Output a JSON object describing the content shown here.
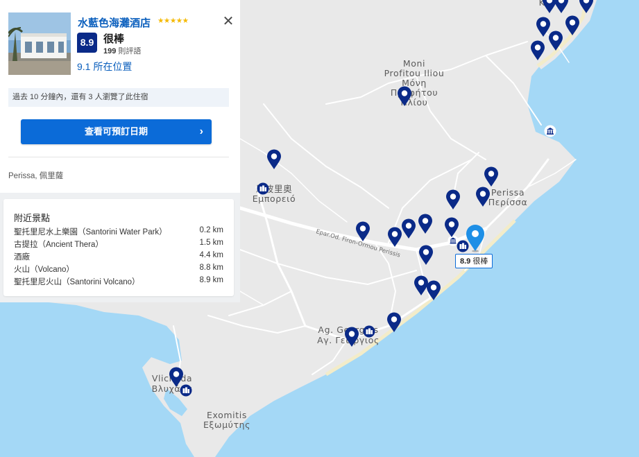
{
  "hotel": {
    "name": "水藍色海灘酒店",
    "stars": "★★★★★",
    "score": "8.9",
    "score_word": "很棒",
    "review_count": "199",
    "review_suffix": "則評語",
    "location_score": "9.1 所在位置",
    "viewers_text": "過去 10 分鐘內，還有 3 人瀏覽了此住宿",
    "cta_label": "查看可預訂日期",
    "address": "Perissa, 佩里薩"
  },
  "nearby": {
    "title": "附近景點",
    "items": [
      {
        "name": "聖托里尼水上樂園（Santorini Water Park）",
        "distance": "0.2 km"
      },
      {
        "name": "古提拉（Ancient Thera）",
        "distance": "1.5 km"
      },
      {
        "name": "酒廠",
        "distance": "4.4 km"
      },
      {
        "name": "火山（Volcano）",
        "distance": "8.8 km"
      },
      {
        "name": "聖托里尼火山（Santorini Volcano）",
        "distance": "8.9 km"
      }
    ]
  },
  "map": {
    "labels": {
      "moni1": "Moni",
      "moni2": "Profitou Iliou",
      "moni3": "Μόνη",
      "moni4": "Προφήτου",
      "moni5": "Ηλίου",
      "emporio1": "恩波里奧",
      "emporio2": "Εμπορειό",
      "perissa1": "Perissa",
      "perissa2": "Περίσσα",
      "georgios1": "Ag. Georgios",
      "georgios2": "Αγ. Γεώργιος",
      "vlichada1": "Vlichada",
      "vlichada2": "Βλυχάδα",
      "exomitis1": "Exomitis",
      "exomitis2": "Εξωμύτης",
      "road": "Epar.Od. Firon-Ormou Perissis",
      "kamari_partial": "K"
    },
    "selected_tag_score": "8.9",
    "selected_tag_word": "很棒",
    "colors": {
      "pin": "#0a2a88",
      "selected_pin": "#1e8fe6",
      "sea": "#a4d8f6",
      "land": "#e9e9e9"
    }
  }
}
